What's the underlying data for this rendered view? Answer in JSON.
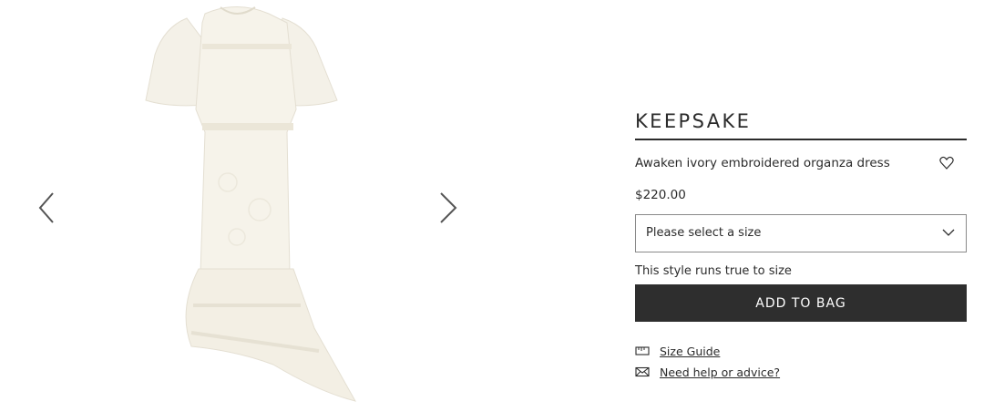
{
  "gallery": {
    "image_alt": "Awaken ivory embroidered organza dress",
    "prev_icon": "chevron-left-icon",
    "next_icon": "chevron-right-icon"
  },
  "product": {
    "brand": "KEEPSAKE",
    "name": "Awaken ivory embroidered organza dress",
    "price": "$220.00",
    "wishlist_icon": "heart-icon"
  },
  "size": {
    "placeholder": "Please select a size",
    "icon": "chevron-down-icon",
    "fit_note": "This style runs true to size"
  },
  "actions": {
    "add_to_bag": "ADD TO BAG",
    "size_guide": "Size Guide",
    "size_guide_icon": "ruler-icon",
    "help": "Need help or advice?",
    "help_icon": "envelope-icon"
  },
  "colors": {
    "text": "#2b2b2b",
    "button_bg": "#2e2e2e",
    "button_text": "#ffffff",
    "dress": "#f4f1e8"
  }
}
